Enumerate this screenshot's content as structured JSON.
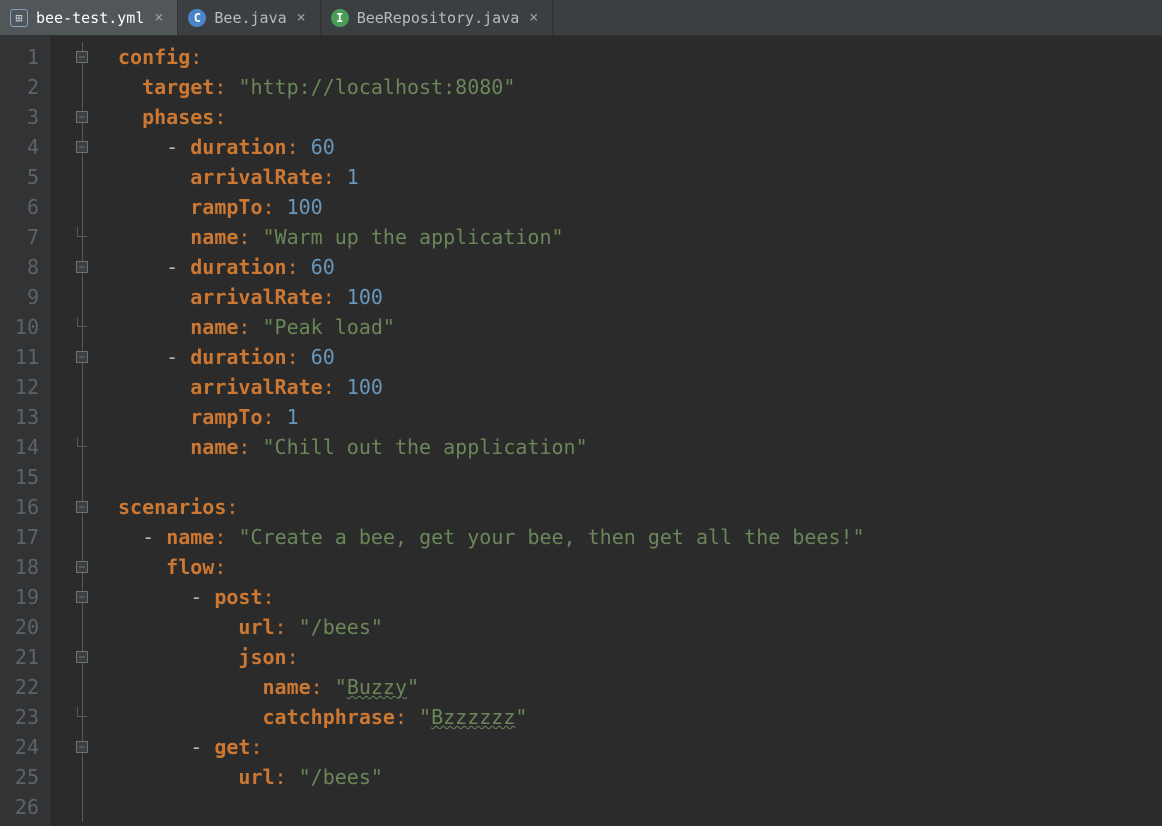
{
  "tabs": [
    {
      "label": "bee-test.yml",
      "active": true,
      "iconClass": "yml",
      "iconText": "⊞"
    },
    {
      "label": "Bee.java",
      "active": false,
      "iconClass": "c",
      "iconText": "C"
    },
    {
      "label": "BeeRepository.java",
      "active": false,
      "iconClass": "i",
      "iconText": "I"
    }
  ],
  "lineCount": 26,
  "code": [
    {
      "indent": 0,
      "tokens": [
        [
          "k",
          "config"
        ],
        [
          "p",
          ":"
        ]
      ]
    },
    {
      "indent": 1,
      "tokens": [
        [
          "k",
          "target"
        ],
        [
          "p",
          ": "
        ],
        [
          "s",
          "\"http://localhost:8080\""
        ]
      ]
    },
    {
      "indent": 1,
      "tokens": [
        [
          "k",
          "phases"
        ],
        [
          "p",
          ":"
        ]
      ]
    },
    {
      "indent": 2,
      "tokens": [
        [
          "d",
          "- "
        ],
        [
          "k",
          "duration"
        ],
        [
          "p",
          ": "
        ],
        [
          "n",
          "60"
        ]
      ]
    },
    {
      "indent": 3,
      "tokens": [
        [
          "k",
          "arrivalRate"
        ],
        [
          "p",
          ": "
        ],
        [
          "n",
          "1"
        ]
      ]
    },
    {
      "indent": 3,
      "tokens": [
        [
          "k",
          "rampTo"
        ],
        [
          "p",
          ": "
        ],
        [
          "n",
          "100"
        ]
      ]
    },
    {
      "indent": 3,
      "tokens": [
        [
          "k",
          "name"
        ],
        [
          "p",
          ": "
        ],
        [
          "s",
          "\"Warm up the application\""
        ]
      ]
    },
    {
      "indent": 2,
      "tokens": [
        [
          "d",
          "- "
        ],
        [
          "k",
          "duration"
        ],
        [
          "p",
          ": "
        ],
        [
          "n",
          "60"
        ]
      ]
    },
    {
      "indent": 3,
      "tokens": [
        [
          "k",
          "arrivalRate"
        ],
        [
          "p",
          ": "
        ],
        [
          "n",
          "100"
        ]
      ]
    },
    {
      "indent": 3,
      "tokens": [
        [
          "k",
          "name"
        ],
        [
          "p",
          ": "
        ],
        [
          "s",
          "\"Peak load\""
        ]
      ]
    },
    {
      "indent": 2,
      "tokens": [
        [
          "d",
          "- "
        ],
        [
          "k",
          "duration"
        ],
        [
          "p",
          ": "
        ],
        [
          "n",
          "60"
        ]
      ]
    },
    {
      "indent": 3,
      "tokens": [
        [
          "k",
          "arrivalRate"
        ],
        [
          "p",
          ": "
        ],
        [
          "n",
          "100"
        ]
      ]
    },
    {
      "indent": 3,
      "tokens": [
        [
          "k",
          "rampTo"
        ],
        [
          "p",
          ": "
        ],
        [
          "n",
          "1"
        ]
      ]
    },
    {
      "indent": 3,
      "tokens": [
        [
          "k",
          "name"
        ],
        [
          "p",
          ": "
        ],
        [
          "s",
          "\"Chill out the application\""
        ]
      ]
    },
    {
      "indent": 0,
      "tokens": []
    },
    {
      "indent": 0,
      "tokens": [
        [
          "k",
          "scenarios"
        ],
        [
          "p",
          ":"
        ]
      ]
    },
    {
      "indent": 1,
      "tokens": [
        [
          "d",
          "- "
        ],
        [
          "k",
          "name"
        ],
        [
          "p",
          ": "
        ],
        [
          "s",
          "\"Create a bee, get your bee, then get all the bees!\""
        ]
      ]
    },
    {
      "indent": 2,
      "tokens": [
        [
          "k",
          "flow"
        ],
        [
          "p",
          ":"
        ]
      ]
    },
    {
      "indent": 3,
      "tokens": [
        [
          "d",
          "- "
        ],
        [
          "k",
          "post"
        ],
        [
          "p",
          ":"
        ]
      ]
    },
    {
      "indent": 5,
      "tokens": [
        [
          "k",
          "url"
        ],
        [
          "p",
          ": "
        ],
        [
          "s",
          "\"/bees\""
        ]
      ]
    },
    {
      "indent": 5,
      "tokens": [
        [
          "k",
          "json"
        ],
        [
          "p",
          ":"
        ]
      ]
    },
    {
      "indent": 6,
      "tokens": [
        [
          "k",
          "name"
        ],
        [
          "p",
          ": "
        ],
        [
          "s",
          "\""
        ],
        [
          "u",
          "Buzzy"
        ],
        [
          "s",
          "\""
        ]
      ]
    },
    {
      "indent": 6,
      "tokens": [
        [
          "k",
          "catchphrase"
        ],
        [
          "p",
          ": "
        ],
        [
          "s",
          "\""
        ],
        [
          "u",
          "Bzzzzzz"
        ],
        [
          "s",
          "\""
        ]
      ]
    },
    {
      "indent": 3,
      "tokens": [
        [
          "d",
          "- "
        ],
        [
          "k",
          "get"
        ],
        [
          "p",
          ":"
        ]
      ]
    },
    {
      "indent": 5,
      "tokens": [
        [
          "k",
          "url"
        ],
        [
          "p",
          ": "
        ],
        [
          "s",
          "\"/bees\""
        ]
      ]
    },
    {
      "indent": 0,
      "tokens": []
    }
  ],
  "foldMarkers": {
    "1": "open",
    "3": "open",
    "4": "open",
    "7": "end",
    "8": "open",
    "10": "end",
    "11": "open",
    "14": "end",
    "16": "open",
    "17": "line",
    "18": "open",
    "19": "open",
    "21": "open",
    "23": "end",
    "24": "open",
    "25": "line",
    "26": "line"
  }
}
